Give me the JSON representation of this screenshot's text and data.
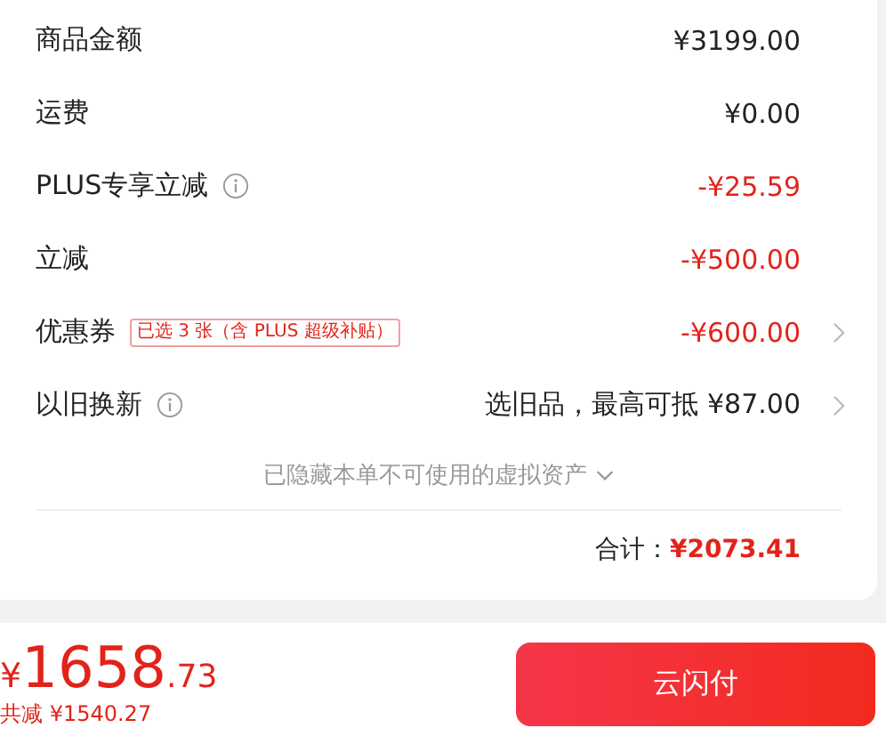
{
  "rows": [
    {
      "label": "商品金额",
      "info": false,
      "value": "¥3199.00",
      "kind": "amount",
      "chevron": false
    },
    {
      "label": "运费",
      "info": false,
      "value": "¥0.00",
      "kind": "amount",
      "chevron": false
    },
    {
      "label": "PLUS专享立减",
      "info": true,
      "value": "-¥25.59",
      "kind": "deduction",
      "chevron": false
    },
    {
      "label": "立减",
      "info": false,
      "value": "-¥500.00",
      "kind": "deduction",
      "chevron": false
    },
    {
      "label": "优惠券",
      "info": false,
      "tag": "已选 3 张（含 PLUS 超级补贴）",
      "value": "-¥600.00",
      "kind": "deduction",
      "chevron": true
    },
    {
      "label": "以旧换新",
      "info": true,
      "value": "选旧品，最高可抵 ¥87.00",
      "kind": "amount",
      "chevron": true
    }
  ],
  "hidden_note": "已隐藏本单不可使用的虚拟资产",
  "total": {
    "label": "合计：",
    "value": "¥2073.41"
  },
  "footer": {
    "currency": "¥",
    "price_integer": "1658",
    "price_decimal": ".73",
    "saved": "共减 ¥1540.27",
    "pay_button": "云闪付"
  }
}
